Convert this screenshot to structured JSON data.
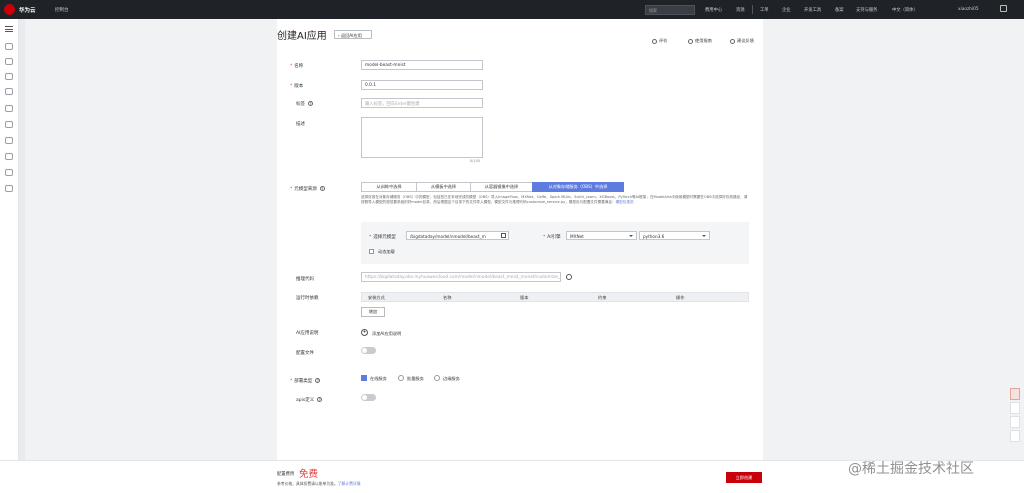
{
  "topbar": {
    "brand": "华为云",
    "console": "控制台",
    "search_placeholder": "搜索",
    "nav": [
      "费用中心",
      "资源",
      "工单",
      "企业",
      "开发工具",
      "备案",
      "支持与服务",
      "中文（简体）",
      "xiaozhi05"
    ]
  },
  "page": {
    "title": "创建AI应用",
    "back_label": "返回AI应用",
    "top_links": [
      "评价",
      "使用指南",
      "建议反馈"
    ]
  },
  "form": {
    "name_label": "名称",
    "name_value": "model-beast-mnist",
    "version_label": "版本",
    "version_value": "0.0.1",
    "tag_label": "标签",
    "tag_placeholder": "输入标签，回车Enter键创建",
    "desc_label": "描述",
    "desc_counter": "0/100",
    "meta_source_label": "元模型来源",
    "source_tabs": [
      "从训练中选择",
      "从模板中选择",
      "从容器镜像中选择",
      "从对象存储服务（OBS）中选择"
    ],
    "source_active_index": 3,
    "source_desc": "选择存放在对象存储服务（OBS）中的模型，包括您已在本地完成的模型（OBS）导入ImageFlow、MXNet、Caffe、Spark MLlib、Scikit_Learn、XGBoost、PyTorch等AI框架，在ModelArts中使用模型时需要在OBS中选择好存放路径，请按照导入模型的规范要求组织好model目录，然后根据这个目录下的文件导入模型。模型文件与推理代码customize_service.py，模型包与配置文件需要满足：",
    "source_desc_link": "模型包规范",
    "select_model_label": "选择元模型",
    "select_model_value": "/bigdataday/model/nmodel/beast_m",
    "ai_engine_label": "AI引擎",
    "ai_engine_value": "MXNet",
    "runtime_value": "python3.6",
    "dynamic_load_label": "动态加载",
    "inference_code_label": "推理代码",
    "inference_code_value": "https://bigdataday.obs.myhuaweicloud.com/model/nmodel/beast_mnist_mxnet/customize_service.py",
    "runtime_deps_label": "运行时依赖",
    "table_headers": [
      "安装方式",
      "名称",
      "版本",
      "约束",
      "操作"
    ],
    "add_button": "增加",
    "app_desc_label": "AI应用说明",
    "add_app_desc": "添加AI应用说明",
    "config_file_label": "配置文件",
    "deploy_type_label": "部署类型",
    "deploy_options": [
      "在线服务",
      "批量服务",
      "边缘服务"
    ],
    "deploy_checked": [
      true,
      false,
      false
    ],
    "api_label": "apis定义"
  },
  "footer": {
    "fee_label": "配置费用",
    "fee_value": "免费",
    "note_prefix": "参考价格，具体扣费请以账单为准。",
    "note_link": "了解计费详情",
    "create_button": "立即创建"
  },
  "watermark": "@稀土掘金技术社区",
  "colors": {
    "accent": "#5e7ce0",
    "danger": "#c7000b",
    "topbar": "#1f2227"
  }
}
